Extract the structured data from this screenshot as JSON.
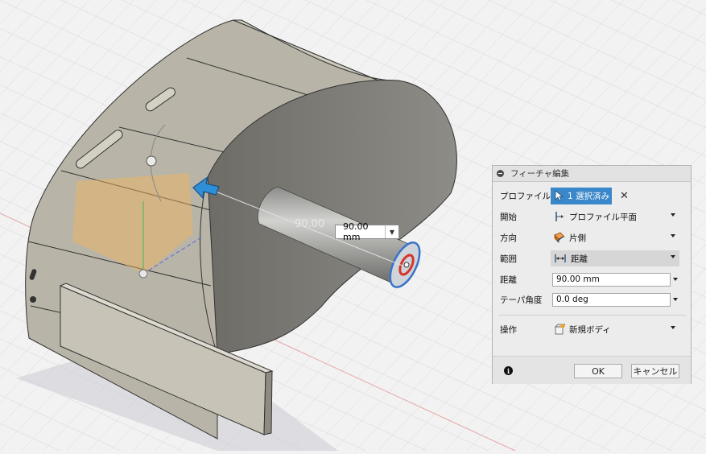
{
  "viewport": {
    "dimension_ghost": "90.00",
    "dimension_input": "90.00 mm"
  },
  "dialog": {
    "title": "フィーチャ編集",
    "profile": {
      "label": "プロファイル",
      "value": "1 選択済み"
    },
    "start": {
      "label": "開始",
      "value": "プロファイル平面"
    },
    "direction": {
      "label": "方向",
      "value": "片側"
    },
    "extent": {
      "label": "範囲",
      "value": "距離"
    },
    "distance": {
      "label": "距離",
      "value": "90.00 mm"
    },
    "taper": {
      "label": "テーパ角度",
      "value": "0.0 deg"
    },
    "operation": {
      "label": "操作",
      "value": "新規ボディ"
    },
    "ok_label": "OK",
    "cancel_label": "キャンセル"
  },
  "colors": {
    "accent": "#3a87c9",
    "selection_red": "#d7342a",
    "preview_orange": "#f5b45a"
  }
}
